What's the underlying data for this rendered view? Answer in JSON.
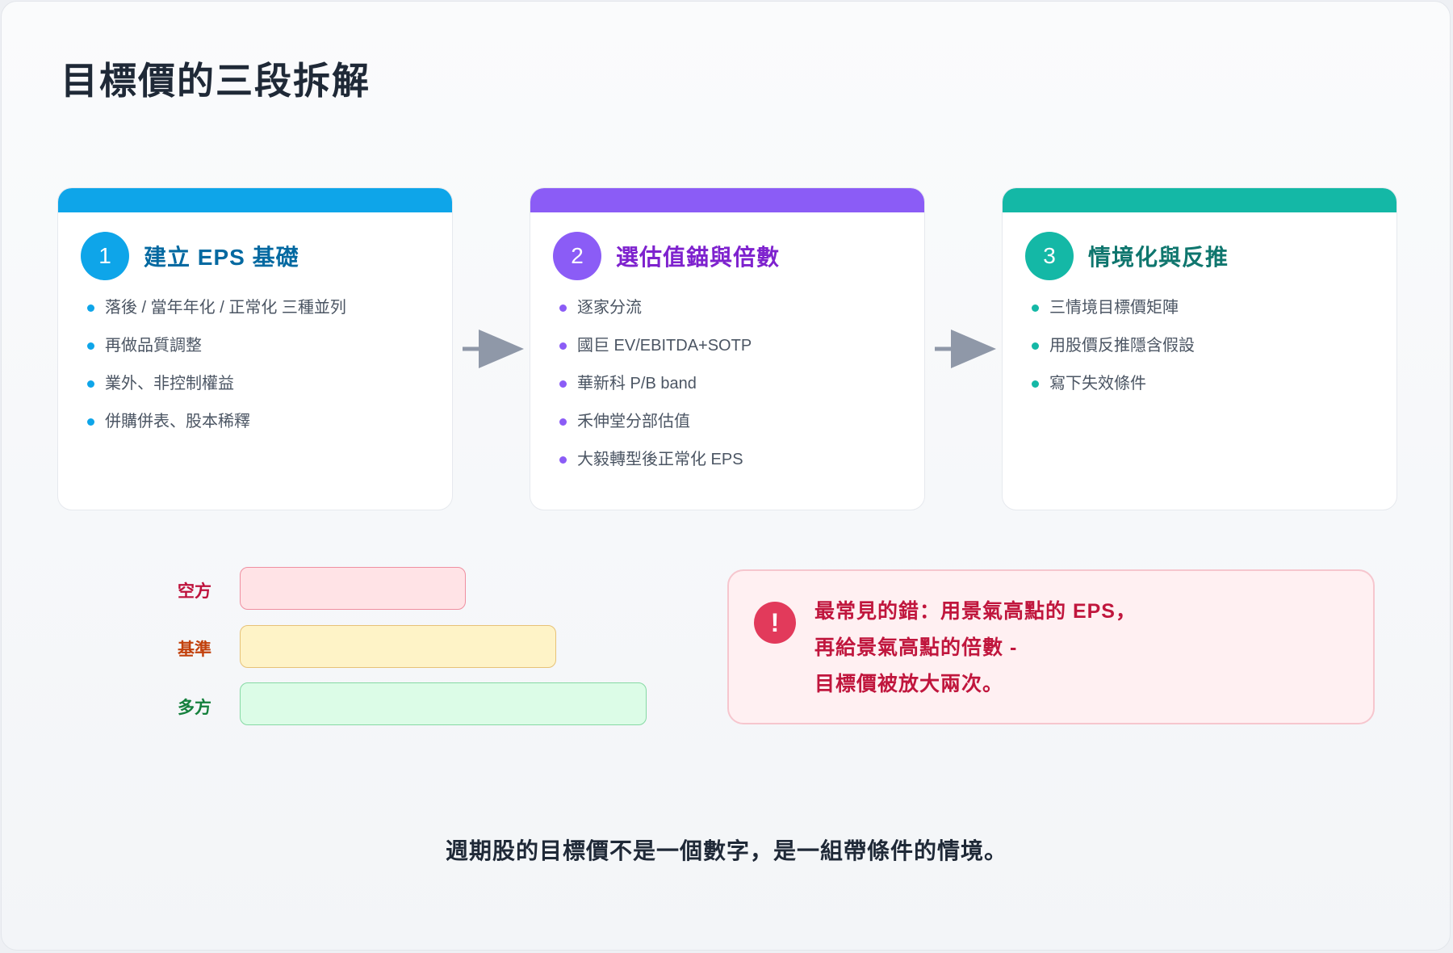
{
  "title": "目標價的三段拆解",
  "steps": [
    {
      "number": "1",
      "title": "建立 EPS 基礎",
      "color": "#0ea5e9",
      "title_color": "#0369a1",
      "items": [
        "落後 / 當年年化 / 正常化 三種並列",
        "再做品質調整",
        "業外、非控制權益",
        "併購併表、股本稀釋"
      ]
    },
    {
      "number": "2",
      "title": "選估值錨與倍數",
      "color": "#8b5cf6",
      "title_color": "#7e22ce",
      "items": [
        "逐家分流",
        "國巨 EV/EBITDA+SOTP",
        "華新科 P/B band",
        "禾伸堂分部估值",
        "大毅轉型後正常化 EPS"
      ]
    },
    {
      "number": "3",
      "title": "情境化與反推",
      "color": "#14b8a6",
      "title_color": "#0f766e",
      "items": [
        "三情境目標價矩陣",
        "用股價反推隱含假設",
        "寫下失效條件"
      ]
    }
  ],
  "arrow_color": "#8f98a8",
  "scenarios": [
    {
      "label": "空方",
      "level": 0.5,
      "label_color": "#be123c",
      "fill": "#ffe3e6",
      "border": "#ef8fa0"
    },
    {
      "label": "基準",
      "level": 0.7,
      "label_color": "#c2410c",
      "fill": "#fef3c7",
      "border": "#e7c277"
    },
    {
      "label": "多方",
      "level": 0.9,
      "label_color": "#15803d",
      "fill": "#dcfce7",
      "border": "#86d9a4"
    }
  ],
  "warning": {
    "icon": "!",
    "lines": [
      "最常見的錯：用景氣高點的 EPS，",
      "再給景氣高點的倍數 -",
      "目標價被放大兩次。"
    ]
  },
  "footer": "週期股的目標價不是一個數字，是一組帶條件的情境。"
}
